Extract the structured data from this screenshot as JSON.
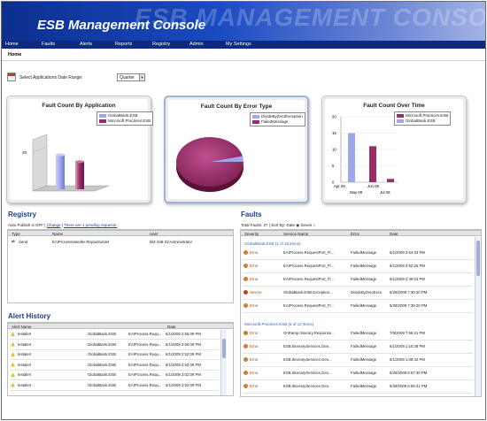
{
  "app": {
    "title": "ESB Management Console",
    "watermark": "ESB MANAGEMENT CONSOLE"
  },
  "nav": [
    "Home",
    "Faults",
    "Alerts",
    "Reports",
    "Registry",
    "Admin",
    "My Settings"
  ],
  "breadcrumb": "Home",
  "date_range": {
    "label": "Select Applications Date Range:",
    "value": "Quarter"
  },
  "charts": {
    "by_app": {
      "title": "Fault Count By Application",
      "legend": [
        "GlobalBank.ESB",
        "Microsoft.Practices.ESB"
      ],
      "ytick": "20"
    },
    "by_type": {
      "title": "Fault Count By Error Type",
      "legend": [
        "DivideByZeroException",
        "FailedMessage"
      ]
    },
    "over_time": {
      "title": "Fault Count Over Time",
      "legend": [
        "Microsoft.Practices.ESB",
        "GlobalBank.ESB"
      ],
      "yticks": [
        "0",
        "5",
        "10",
        "15",
        "20"
      ],
      "xticks_top": [
        "Apr 09",
        "Jun 09"
      ],
      "xticks_bottom": [
        "May 09",
        "Jul 09"
      ]
    }
  },
  "chart_data": [
    {
      "type": "bar",
      "title": "Fault Count By Application",
      "categories": [
        "GlobalBank.ESB",
        "Microsoft.Practices.ESB"
      ],
      "values": [
        15,
        12
      ]
    },
    {
      "type": "pie",
      "title": "Fault Count By Error Type",
      "categories": [
        "DivideByZeroException",
        "FailedMessage"
      ],
      "values": [
        1,
        26
      ]
    },
    {
      "type": "bar",
      "title": "Fault Count Over Time",
      "categories": [
        "May 09",
        "Jun 09",
        "Jul 09"
      ],
      "series": [
        {
          "name": "GlobalBank.ESB",
          "values": [
            15,
            0,
            0
          ]
        },
        {
          "name": "Microsoft.Practices.ESB",
          "values": [
            0,
            11,
            1
          ]
        }
      ],
      "ylim": [
        0,
        20
      ]
    }
  ],
  "registry": {
    "title": "Registry",
    "publish_status": "Auto Publish is OFF |",
    "change": "Change",
    "pending": "There are 1 pending requests.",
    "columns": [
      "Type",
      "Name",
      "User"
    ],
    "rows": [
      {
        "type": "Send",
        "name": "EAIProcessHandler.RepairSubmit",
        "user": "BIZ-348-01\\Administrator"
      }
    ]
  },
  "faults": {
    "title": "Faults",
    "summary": "Total Faults: 27 | Sort By:",
    "sort_opt1": "Date",
    "sort_opt2": "Severi",
    "columns": [
      "Severity",
      "Service Name",
      "Error",
      "Date"
    ],
    "groups": [
      {
        "name": "GlobalBank.ESB (1 of 15 items)",
        "rows": [
          {
            "sev": "Error",
            "svc": "EAIProcess.RequestPort_Fl...",
            "err": "FailedMessage",
            "date": "6/1/2009 2:54:33 PM"
          },
          {
            "sev": "Error",
            "svc": "EAIProcess.RequestPort_Fl...",
            "err": "FailedMessage",
            "date": "6/1/2009 2:52:26 PM"
          },
          {
            "sev": "Error",
            "svc": "EAIProcess.RequestPort_Fl...",
            "err": "FailedMessage",
            "date": "6/1/2009 2:49:53 PM"
          },
          {
            "sev": "Severe",
            "svc": "GlobalBank.ESB.Exception...",
            "err": "DivideByZeroExce",
            "date": "5/29/2009 7:39:20 PM"
          },
          {
            "sev": "Error",
            "svc": "EAIProcess.RequestPort_Fl...",
            "err": "FailedMessage",
            "date": "5/29/2009 7:39:20 PM"
          }
        ]
      },
      {
        "name": "Microsoft.Practices.ESB (5 of 12 items)",
        "rows": [
          {
            "sev": "Error",
            "svc": "OnRamp.Itinerary.Response...",
            "err": "FailedMessage",
            "date": "7/9/2009 7:55:21 PM"
          },
          {
            "sev": "Error",
            "svc": "ESB.ItineraryServices.Gen...",
            "err": "FailedMessage",
            "date": "6/1/2009 1:10:38 PM"
          },
          {
            "sev": "Error",
            "svc": "ESB.ItineraryServices.Gen...",
            "err": "FailedMessage",
            "date": "6/1/2009 1:09:42 PM"
          },
          {
            "sev": "Error",
            "svc": "ESB.ItineraryServices.Gen...",
            "err": "FailedMessage",
            "date": "5/29/2009 6:57:30 PM"
          },
          {
            "sev": "Error",
            "svc": "ESB.ItineraryServices.Gen...",
            "err": "FailedMessage",
            "date": "5/29/2009 6:55:31 PM"
          }
        ]
      }
    ]
  },
  "alerts": {
    "title": "Alert History",
    "columns": [
      "Alert Name",
      "",
      "Date"
    ],
    "rows": [
      {
        "name": "testalert",
        "app": "GlobalBank.ESB",
        "svc": "EAIProcess.Requ...",
        "date": "6/1/2009 2:55:09 PM"
      },
      {
        "name": "testalert",
        "app": "GlobalBank.ESB",
        "svc": "EAIProcess.Requ...",
        "date": "6/1/2009 2:55:09 PM"
      },
      {
        "name": "testalert",
        "app": "GlobalBank.ESB",
        "svc": "EAIProcess.Requ...",
        "date": "6/1/2009 2:52:09 PM"
      },
      {
        "name": "testalert",
        "app": "GlobalBank.ESB",
        "svc": "EAIProcess.Requ...",
        "date": "6/1/2009 2:52:09 PM"
      },
      {
        "name": "testalert",
        "app": "GlobalBank.ESB",
        "svc": "EAIProcess.Requ...",
        "date": "6/1/2009 2:52:09 PM"
      },
      {
        "name": "testalert",
        "app": "GlobalBank.ESB",
        "svc": "EAIProcess.Requ...",
        "date": "6/1/2009 2:52:09 PM"
      }
    ]
  },
  "colors": {
    "header": "#1a4bc2",
    "nav": "#0c2a80",
    "section_title": "#1f3e8c",
    "series_blue": "#9fa6ee",
    "series_maroon": "#9a2c66"
  }
}
